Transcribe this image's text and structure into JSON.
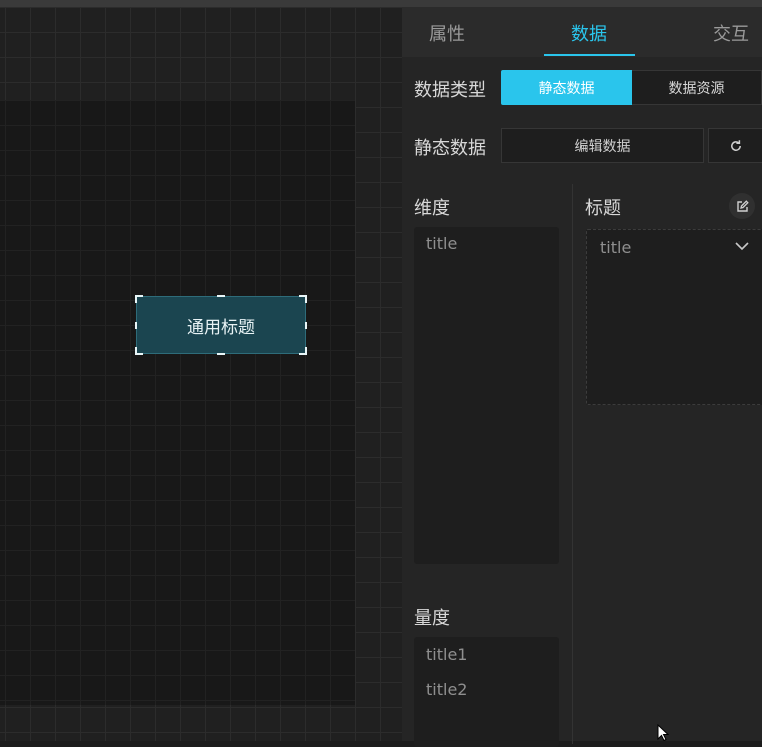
{
  "canvas": {
    "component_label": "通用标题"
  },
  "panel": {
    "tabs": [
      {
        "label": "属性",
        "active": false
      },
      {
        "label": "数据",
        "active": true
      },
      {
        "label": "交互",
        "active": false
      }
    ],
    "data_type_label": "数据类型",
    "data_type_options": [
      "静态数据",
      "数据资源"
    ],
    "data_type_selected": "静态数据",
    "static_data_label": "静态数据",
    "edit_data_button": "编辑数据",
    "dimension": {
      "title": "维度",
      "items": [
        "title"
      ]
    },
    "measure": {
      "title": "量度",
      "items": [
        "title1",
        "title2"
      ]
    },
    "title_field": {
      "label": "标题",
      "selected": "title"
    }
  },
  "colors": {
    "accent": "#2ac5ec",
    "component_fill": "#1b4550",
    "panel_bg": "#252525"
  },
  "icons": [
    "refresh-icon",
    "edit-icon",
    "chevron-down-icon",
    "mouse-cursor-icon"
  ]
}
